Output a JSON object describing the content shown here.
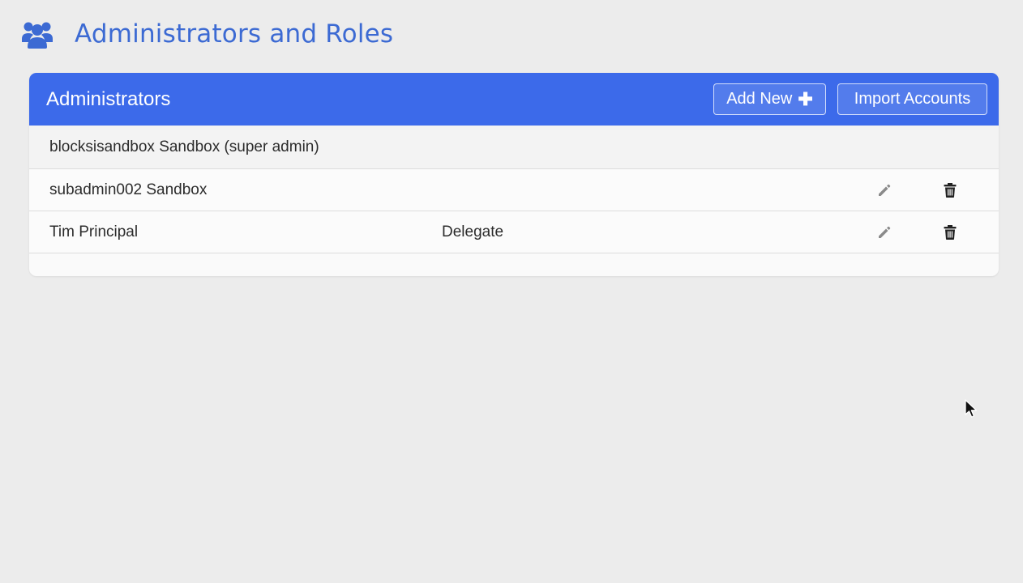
{
  "page": {
    "title": "Administrators and Roles",
    "icon": "users-icon",
    "accent_color": "#3c6ad3"
  },
  "panel": {
    "title": "Administrators",
    "header_color": "#3c6aea",
    "add_new_label": "Add New",
    "add_new_icon": "plus-icon",
    "import_label": "Import Accounts"
  },
  "administrators": [
    {
      "name": "blocksisandbox Sandbox (super admin)",
      "role": "",
      "editable": false
    },
    {
      "name": "subadmin002 Sandbox",
      "role": "",
      "editable": true
    },
    {
      "name": "Tim Principal",
      "role": "Delegate",
      "editable": true
    }
  ],
  "row_actions": {
    "edit_icon": "pencil-icon",
    "delete_icon": "trash-icon"
  }
}
